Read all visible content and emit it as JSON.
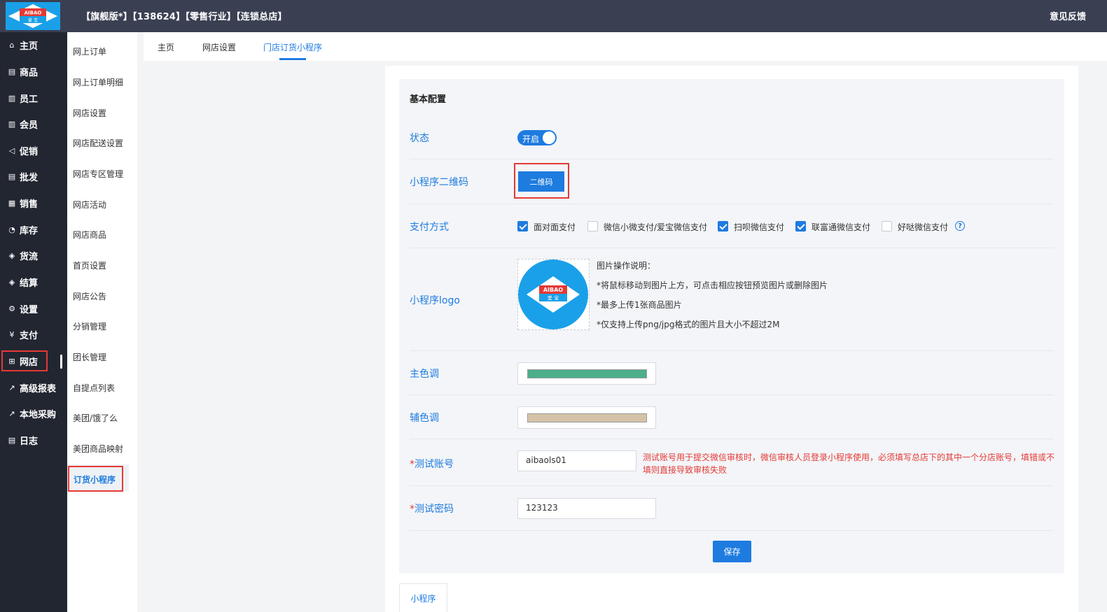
{
  "header": {
    "store_info": "【旗舰版*】【138624】【零售行业】【连锁总店】",
    "feedback": "意见反馈",
    "logo_text": "AIBAO",
    "logo_subtext": "爱 宝"
  },
  "sidebar": {
    "items": [
      {
        "label": "主页",
        "icon": "home-icon"
      },
      {
        "label": "商品",
        "icon": "goods-icon"
      },
      {
        "label": "员工",
        "icon": "staff-icon"
      },
      {
        "label": "会员",
        "icon": "member-icon"
      },
      {
        "label": "促销",
        "icon": "promo-icon"
      },
      {
        "label": "批发",
        "icon": "wholesale-icon"
      },
      {
        "label": "销售",
        "icon": "sales-icon"
      },
      {
        "label": "库存",
        "icon": "inventory-icon"
      },
      {
        "label": "货流",
        "icon": "logistics-icon"
      },
      {
        "label": "结算",
        "icon": "settlement-icon"
      },
      {
        "label": "设置",
        "icon": "settings-icon"
      },
      {
        "label": "支付",
        "icon": "payment-icon"
      },
      {
        "label": "网店",
        "icon": "shop-icon"
      },
      {
        "label": "高级报表",
        "icon": "report-icon"
      },
      {
        "label": "本地采购",
        "icon": "purchase-icon"
      },
      {
        "label": "日志",
        "icon": "log-icon"
      }
    ],
    "active": "网店"
  },
  "subnav": {
    "items": [
      "网上订单",
      "网上订单明细",
      "网店设置",
      "网店配送设置",
      "网店专区管理",
      "网店活动",
      "网店商品",
      "首页设置",
      "网店公告",
      "分销管理",
      "团长管理",
      "自提点列表",
      "美团/饿了么",
      "美团商品映射",
      "订货小程序"
    ],
    "active": "订货小程序"
  },
  "tabs": {
    "items": [
      "主页",
      "网店设置",
      "门店订货小程序"
    ],
    "active": "门店订货小程序"
  },
  "form": {
    "section_title": "基本配置",
    "status_label": "状态",
    "status_value": "开启",
    "qr_label": "小程序二维码",
    "qr_button": "二维码",
    "payment_label": "支付方式",
    "payment_options": [
      {
        "label": "面对面支付",
        "checked": true
      },
      {
        "label": "微信小微支付/爱宝微信支付",
        "checked": false
      },
      {
        "label": "扫呗微信支付",
        "checked": true
      },
      {
        "label": "联富通微信支付",
        "checked": true
      },
      {
        "label": "好哒微信支付",
        "checked": false
      }
    ],
    "logo_label": "小程序logo",
    "image_notes": [
      "图片操作说明：",
      "*将鼠标移动到图片上方，可点击相应按钮预览图片或删除图片",
      "*最多上传1张商品图片",
      "*仅支持上传png/jpg格式的图片且大小不超过2M"
    ],
    "main_color_label": "主色调",
    "main_color": "#4caf8a",
    "sub_color_label": "辅色调",
    "sub_color": "#d4c3a8",
    "test_account_label": "测试账号",
    "test_account_value": "aibaols01",
    "test_account_warning": "测试账号用于提交微信审核时，微信审核人员登录小程序使用，必须填写总店下的其中一个分店账号，填错或不填则直接导致审核失败",
    "test_password_label": "测试密码",
    "test_password_value": "123123",
    "required_mark": "*",
    "save_button": "保存"
  },
  "bottom_tab": "小程序",
  "colors": {
    "accent": "#1e7be0",
    "danger": "#e53935",
    "header_bg": "#3a3f52",
    "sidebar_bg": "#222631"
  }
}
